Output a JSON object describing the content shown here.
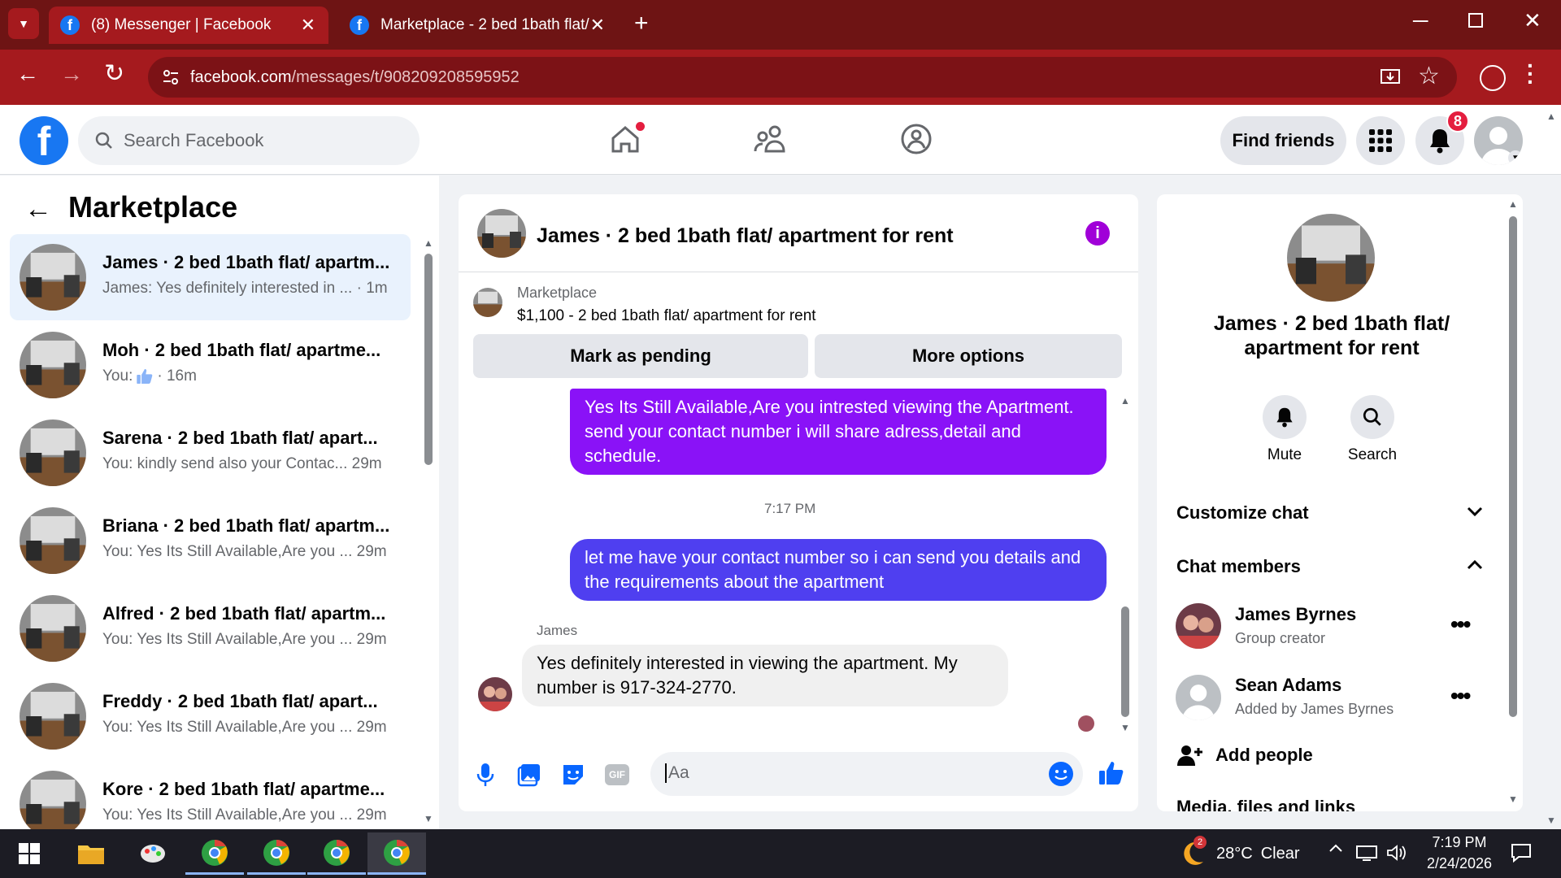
{
  "browser": {
    "tabs": [
      {
        "title": "(8) Messenger | Facebook"
      },
      {
        "title": "Marketplace - 2 bed 1bath flat/"
      }
    ],
    "url_domain": "facebook.com",
    "url_path": "/messages/t/908209208595952"
  },
  "fb": {
    "search_placeholder": "Search Facebook",
    "find_friends": "Find friends",
    "notification_count": "8"
  },
  "left": {
    "title": "Marketplace",
    "conversations": [
      {
        "name": "James · 2 bed 1bath flat/ apartm...",
        "preview": "James: Yes definitely interested in ...",
        "time": "· 1m",
        "active": true
      },
      {
        "name": "Moh · 2 bed 1bath flat/ apartme...",
        "preview": "You:",
        "time": "· 16m"
      },
      {
        "name": "Sarena · 2 bed 1bath flat/ apart...",
        "preview": "You: kindly send also your Contac...",
        "time": "29m"
      },
      {
        "name": "Briana · 2 bed 1bath flat/ apartm...",
        "preview": "You: Yes Its Still Available,Are you ...",
        "time": "29m"
      },
      {
        "name": "Alfred · 2 bed 1bath flat/ apartm...",
        "preview": "You: Yes Its Still Available,Are you ...",
        "time": "29m"
      },
      {
        "name": "Freddy · 2 bed 1bath flat/ apart...",
        "preview": "You: Yes Its Still Available,Are you ...",
        "time": "29m"
      },
      {
        "name": "Kore · 2 bed 1bath flat/ apartme...",
        "preview": "You: Yes Its Still Available,Are you ...",
        "time": "29m"
      }
    ]
  },
  "chat": {
    "title": "James · 2 bed 1bath flat/ apartment for rent",
    "listing_label": "Marketplace",
    "listing_detail": "$1,100 - 2 bed 1bath flat/ apartment for rent",
    "mark_pending": "Mark as pending",
    "more_options": "More options",
    "msg1": "Yes Its Still Available,Are you intrested viewing the Apartment. send your contact number i will share adress,detail and schedule.",
    "timestamp": "7:17 PM",
    "msg2": "let me have your contact number so i can send you details and the requirements about the apartment",
    "sender": "James",
    "msg3": "Yes definitely interested in viewing the apartment. My number is 917-324-2770.",
    "composer_placeholder": "Aa"
  },
  "right": {
    "title": "James · 2 bed 1bath flat/ apartment for rent",
    "mute": "Mute",
    "search": "Search",
    "customize": "Customize chat",
    "members_header": "Chat members",
    "members": [
      {
        "name": "James Byrnes",
        "role": "Group creator"
      },
      {
        "name": "Sean Adams",
        "role": "Added by James Byrnes"
      }
    ],
    "add_people": "Add people",
    "media": "Media, files and links"
  },
  "taskbar": {
    "weather_temp": "28°C",
    "weather_cond": "Clear",
    "weather_badge": "2",
    "time": "7:19 PM",
    "date": "2/24/2026"
  },
  "colors": {
    "fb_blue": "#1877f2",
    "chrome_red": "#a51a1e",
    "bubble_purple": "#8a12f7",
    "bubble_indigo": "#4f3ff0"
  }
}
